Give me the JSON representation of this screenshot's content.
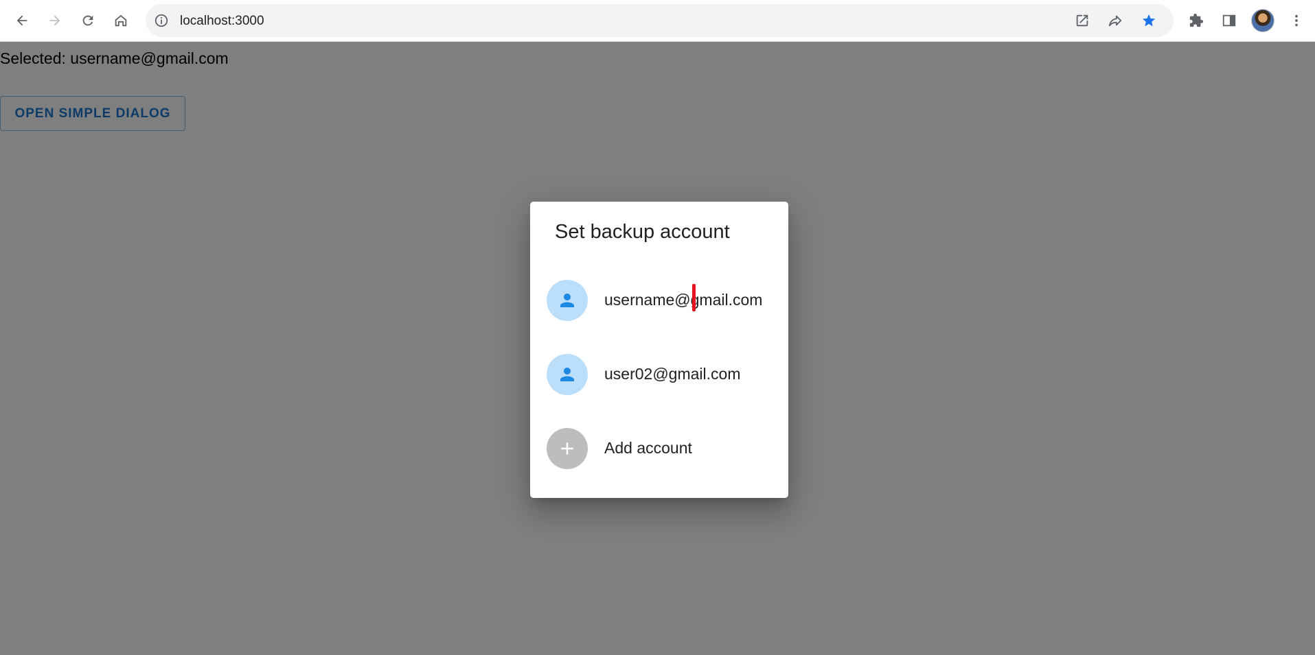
{
  "browser": {
    "url": "localhost:3000",
    "icons": {
      "back": "back-arrow-icon",
      "forward": "forward-arrow-icon",
      "reload": "reload-icon",
      "home": "home-icon",
      "info": "info-icon",
      "open_external": "open-in-new-icon",
      "share": "share-icon",
      "bookmark": "star-icon",
      "extensions": "puzzle-icon",
      "side_panel": "side-panel-icon",
      "menu": "more-vert-icon"
    },
    "bookmark_color": "#1a73e8"
  },
  "page": {
    "selected_text": "Selected: username@gmail.com",
    "open_button_label": "OPEN SIMPLE DIALOG"
  },
  "dialog": {
    "title": "Set backup account",
    "accounts": [
      {
        "label": "username@gmail.com",
        "icon": "person-icon"
      },
      {
        "label": "user02@gmail.com",
        "icon": "person-icon"
      }
    ],
    "add_account": {
      "label": "Add account",
      "icon": "add-icon"
    }
  },
  "colors": {
    "accent": "#1976d2",
    "avatar_bg": "#bbdefb",
    "avatar_icon": "#1e88e5",
    "add_avatar_bg": "#bdbdbd",
    "backdrop": "rgba(0,0,0,0.5)",
    "cursor_mark": "#e8131d"
  }
}
